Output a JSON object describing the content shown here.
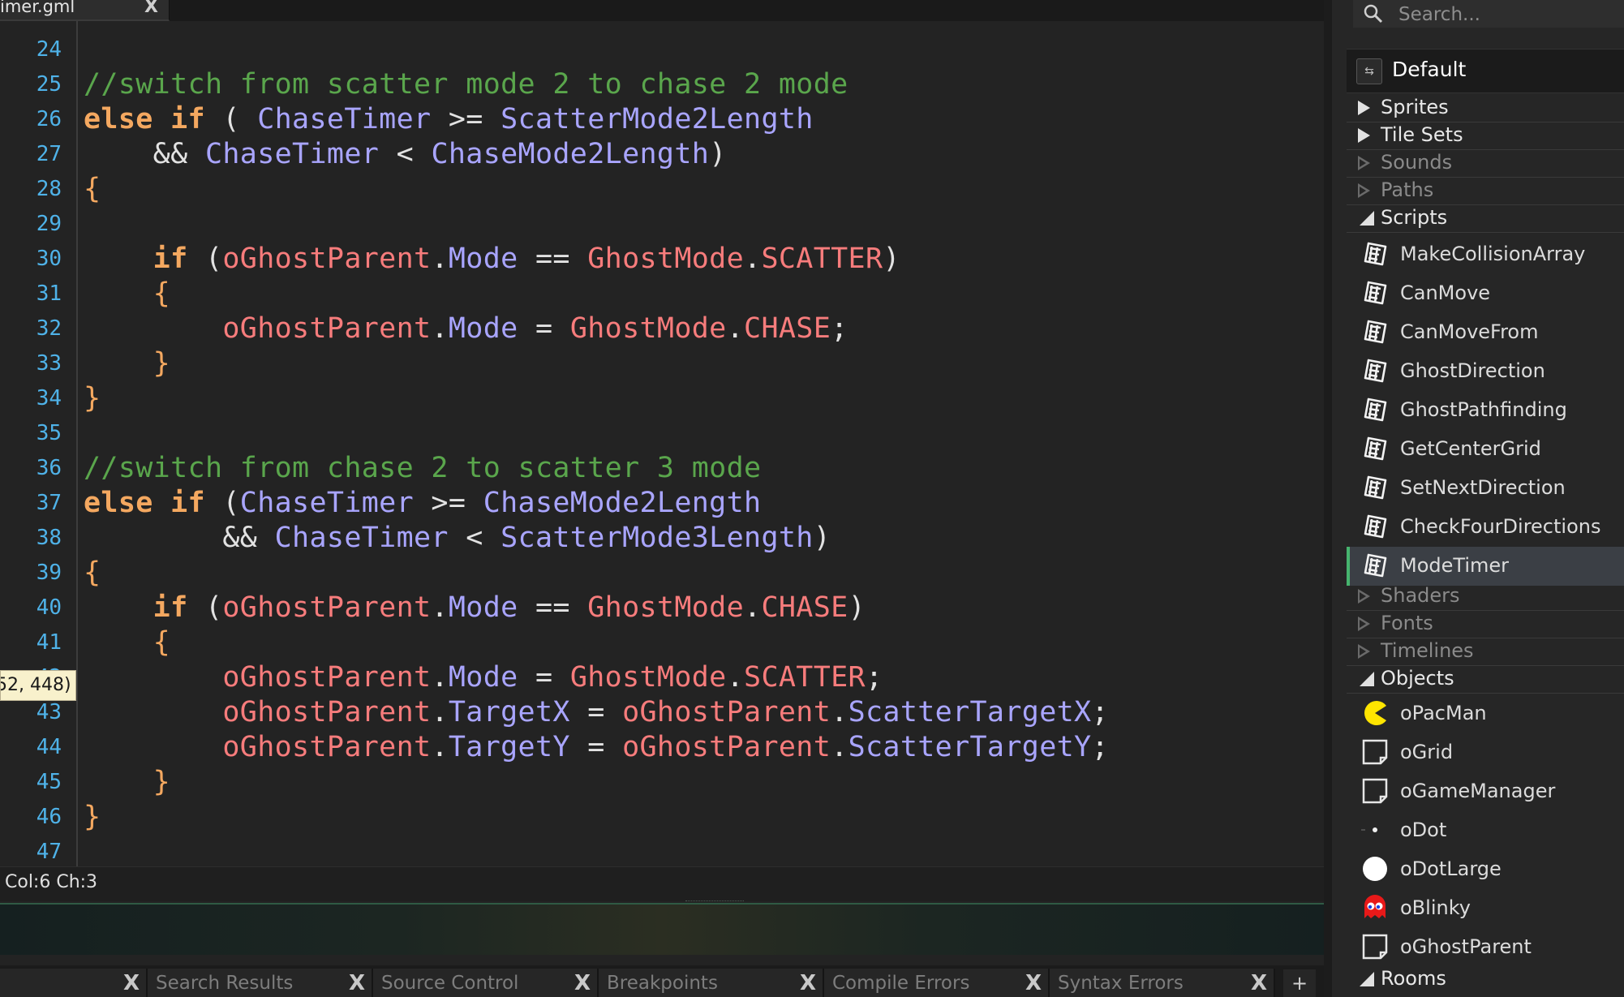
{
  "editor": {
    "file_tab": {
      "name": "imer.gml",
      "close": "X"
    },
    "line_numbers": [
      "24",
      "25",
      "26",
      "27",
      "28",
      "29",
      "30",
      "31",
      "32",
      "33",
      "34",
      "35",
      "36",
      "37",
      "38",
      "39",
      "40",
      "41",
      "42",
      "43",
      "44",
      "45",
      "46",
      "47"
    ],
    "code_lines": [
      [],
      [
        {
          "t": "//switch from scatter mode 2 to chase 2 mode",
          "c": "comment"
        }
      ],
      [
        {
          "t": "else if",
          "c": "kw"
        },
        {
          "t": " ( ",
          "c": "op"
        },
        {
          "t": "ChaseTimer",
          "c": "var"
        },
        {
          "t": " >= ",
          "c": "op"
        },
        {
          "t": "ScatterMode2Length",
          "c": "var"
        }
      ],
      [
        {
          "t": "    && ",
          "c": "op"
        },
        {
          "t": "ChaseTimer",
          "c": "var"
        },
        {
          "t": " < ",
          "c": "op"
        },
        {
          "t": "ChaseMode2Length",
          "c": "var"
        },
        {
          "t": ")",
          "c": "op"
        }
      ],
      [
        {
          "t": "{",
          "c": "brace"
        }
      ],
      [],
      [
        {
          "t": "    if",
          "c": "kw"
        },
        {
          "t": " (",
          "c": "op"
        },
        {
          "t": "oGhostParent",
          "c": "obj"
        },
        {
          "t": ".",
          "c": "op"
        },
        {
          "t": "Mode",
          "c": "var"
        },
        {
          "t": " == ",
          "c": "op"
        },
        {
          "t": "GhostMode",
          "c": "obj"
        },
        {
          "t": ".",
          "c": "op"
        },
        {
          "t": "SCATTER",
          "c": "obj"
        },
        {
          "t": ")",
          "c": "op"
        }
      ],
      [
        {
          "t": "    {",
          "c": "brace"
        }
      ],
      [
        {
          "t": "        oGhostParent",
          "c": "obj"
        },
        {
          "t": ".",
          "c": "op"
        },
        {
          "t": "Mode",
          "c": "var"
        },
        {
          "t": " = ",
          "c": "op"
        },
        {
          "t": "GhostMode",
          "c": "obj"
        },
        {
          "t": ".",
          "c": "op"
        },
        {
          "t": "CHASE",
          "c": "obj"
        },
        {
          "t": ";",
          "c": "op"
        }
      ],
      [
        {
          "t": "    }",
          "c": "brace"
        }
      ],
      [
        {
          "t": "}",
          "c": "brace"
        }
      ],
      [],
      [
        {
          "t": "//switch from chase 2 to scatter 3 mode",
          "c": "comment"
        }
      ],
      [
        {
          "t": "else if",
          "c": "kw"
        },
        {
          "t": " (",
          "c": "op"
        },
        {
          "t": "ChaseTimer",
          "c": "var"
        },
        {
          "t": " >= ",
          "c": "op"
        },
        {
          "t": "ChaseMode2Length",
          "c": "var"
        }
      ],
      [
        {
          "t": "        && ",
          "c": "op"
        },
        {
          "t": "ChaseTimer",
          "c": "var"
        },
        {
          "t": " < ",
          "c": "op"
        },
        {
          "t": "ScatterMode3Length",
          "c": "var"
        },
        {
          "t": ")",
          "c": "op"
        }
      ],
      [
        {
          "t": "{",
          "c": "brace"
        }
      ],
      [
        {
          "t": "    if",
          "c": "kw"
        },
        {
          "t": " (",
          "c": "op"
        },
        {
          "t": "oGhostParent",
          "c": "obj"
        },
        {
          "t": ".",
          "c": "op"
        },
        {
          "t": "Mode",
          "c": "var"
        },
        {
          "t": " == ",
          "c": "op"
        },
        {
          "t": "GhostMode",
          "c": "obj"
        },
        {
          "t": ".",
          "c": "op"
        },
        {
          "t": "CHASE",
          "c": "obj"
        },
        {
          "t": ")",
          "c": "op"
        }
      ],
      [
        {
          "t": "    {",
          "c": "brace"
        }
      ],
      [
        {
          "t": "        oGhostParent",
          "c": "obj"
        },
        {
          "t": ".",
          "c": "op"
        },
        {
          "t": "Mode",
          "c": "var"
        },
        {
          "t": " = ",
          "c": "op"
        },
        {
          "t": "GhostMode",
          "c": "obj"
        },
        {
          "t": ".",
          "c": "op"
        },
        {
          "t": "SCATTER",
          "c": "obj"
        },
        {
          "t": ";",
          "c": "op"
        }
      ],
      [
        {
          "t": "        oGhostParent",
          "c": "obj"
        },
        {
          "t": ".",
          "c": "op"
        },
        {
          "t": "TargetX",
          "c": "var"
        },
        {
          "t": " = ",
          "c": "op"
        },
        {
          "t": "oGhostParent",
          "c": "obj"
        },
        {
          "t": ".",
          "c": "op"
        },
        {
          "t": "ScatterTargetX",
          "c": "var"
        },
        {
          "t": ";",
          "c": "op"
        }
      ],
      [
        {
          "t": "        oGhostParent",
          "c": "obj"
        },
        {
          "t": ".",
          "c": "op"
        },
        {
          "t": "TargetY",
          "c": "var"
        },
        {
          "t": " = ",
          "c": "op"
        },
        {
          "t": "oGhostParent",
          "c": "obj"
        },
        {
          "t": ".",
          "c": "op"
        },
        {
          "t": "ScatterTargetY",
          "c": "var"
        },
        {
          "t": ";",
          "c": "op"
        }
      ],
      [
        {
          "t": "    }",
          "c": "brace"
        }
      ],
      [
        {
          "t": "}",
          "c": "brace"
        }
      ],
      []
    ],
    "tooltip": "52, 448)",
    "status": "Col:6 Ch:3"
  },
  "bottom_tabs": [
    {
      "label": "",
      "close": "X"
    },
    {
      "label": "Search Results",
      "close": "X"
    },
    {
      "label": "Source Control",
      "close": "X"
    },
    {
      "label": "Breakpoints",
      "close": "X"
    },
    {
      "label": "Compile Errors",
      "close": "X"
    },
    {
      "label": "Syntax Errors",
      "close": "X"
    }
  ],
  "add_tab_label": "+",
  "resources": {
    "search_placeholder": "Search...",
    "config_label": "Default",
    "groups": {
      "sprites": "Sprites",
      "tilesets": "Tile Sets",
      "sounds": "Sounds",
      "paths": "Paths",
      "scripts": "Scripts",
      "shaders": "Shaders",
      "fonts": "Fonts",
      "timelines": "Timelines",
      "objects": "Objects",
      "rooms": "Rooms"
    },
    "scripts": [
      "MakeCollisionArray",
      "CanMove",
      "CanMoveFrom",
      "GhostDirection",
      "GhostPathfinding",
      "GetCenterGrid",
      "SetNextDirection",
      "CheckFourDirections",
      "ModeTimer"
    ],
    "selected_script": "ModeTimer",
    "objects": [
      {
        "name": "oPacMan",
        "icon": "pacman-icon"
      },
      {
        "name": "oGrid",
        "icon": "empty-sprite-icon"
      },
      {
        "name": "oGameManager",
        "icon": "empty-sprite-icon"
      },
      {
        "name": "oDot",
        "icon": "dot-icon"
      },
      {
        "name": "oDotLarge",
        "icon": "large-dot-icon"
      },
      {
        "name": "oBlinky",
        "icon": "ghost-icon"
      },
      {
        "name": "oGhostParent",
        "icon": "empty-sprite-icon"
      }
    ],
    "colors": {
      "accent": "#46b46e",
      "line_numbers": "#4fb2e8",
      "comment": "#5aa64c",
      "keyword": "#f4a860",
      "variable": "#a9a5ff",
      "object": "#f77c7c"
    }
  }
}
